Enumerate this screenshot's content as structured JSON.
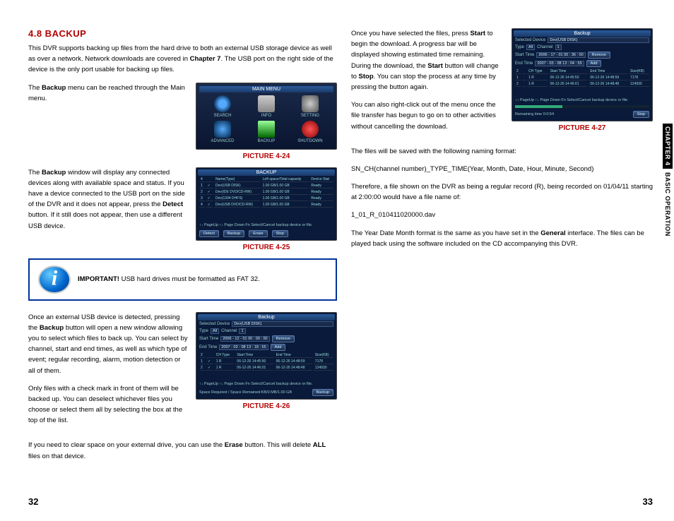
{
  "section": {
    "header": "4.8 BACKUP",
    "intro": "This DVR supports backing up files from the hard drive to both an external USB storage device as well as over a network. Network downloads are covered in ",
    "intro_bold": "Chapter 7",
    "intro2": ". The USB port on the right side of the device is the only port usable for backing up files."
  },
  "p1": {
    "pre": "The ",
    "bold": "Backup",
    "post": " menu can be reached through the Main menu."
  },
  "p2": {
    "pre": "The ",
    "bold": "Backup",
    "post": " window will display any connected devices along with available space and status. If you have a device connected to the USB port on the side of the DVR and it does not appear, press the ",
    "bold2": "Detect",
    "post2": " button. If it still does not appear, then use a different USB device."
  },
  "important": {
    "label": "IMPORTANT!",
    "text": " USB hard drives must be formatted as FAT 32."
  },
  "p3": {
    "pre": "Once an external USB device is detected, pressing the ",
    "bold": "Backup",
    "post": " button will open a new window allowing you to select which files to back up. You can select by channel, start and end times, as well as which type of event; regular recording, alarm, motion detection or all of them."
  },
  "p4": "Only files with a check mark in front of them will be backed up. You can deselect whichever files you choose or select them all by selecting the box at the top of the list.",
  "p5": {
    "pre": "If you need to clear space on your external drive, you can use the ",
    "bold": "Erase",
    "post": " button. This will delete ",
    "bold2": "ALL",
    "post2": " files on that device."
  },
  "r1": {
    "pre": "Once you have selected the files, press ",
    "bold": "Start",
    "mid": " to begin the download. A progress bar will be displayed showing estimated time remaining. During the download, the ",
    "bold2": "Start",
    "mid2": " button will change to ",
    "bold3": "Stop",
    "post": ". You can stop the process at any time by pressing the button again."
  },
  "r2": "You can also right-click out of the menu once the file transfer has begun to go on to other activities without cancelling the download.",
  "r3": "The files will be saved with the following naming format:",
  "r4": "SN_CH(channel number)_TYPE_TIME(Year, Month, Date, Hour, Minute, Second)",
  "r5": "Therefore, a file shown on the DVR as being a regular record (R), being recorded on 01/04/11 starting at 2:00:00 would have a file name of:",
  "r6": "1_01_R_010411020000.dav",
  "r7": {
    "pre": " The Year Date Month format is the same as you have set in the ",
    "bold": "General",
    "post": " interface. The files can be played back using the software included on the CD accompanying this DVR."
  },
  "captions": {
    "c24": "PICTURE 4-24",
    "c25": "PICTURE 4-25",
    "c26": "PICTURE 4-26",
    "c27": "PICTURE 4-27"
  },
  "pages": {
    "left": "32",
    "right": "33"
  },
  "sidetab": {
    "chapter": "CHAPTER 4",
    "rest": " BASIC OPERATION"
  },
  "shot24": {
    "title": "MAIN MENU",
    "items": [
      "SEARCH",
      "INFO",
      "SETTING",
      "ADVANCED",
      "BACKUP",
      "SHUTDOWN"
    ]
  },
  "shot25": {
    "title": "BACKUP",
    "count": "4",
    "rows": [
      [
        "1",
        "✓",
        "Dev(USB DISK)",
        "1.00 GB/1.00 GB",
        "Ready"
      ],
      [
        "2",
        "✓",
        "Dev(IDE DVD/CD-RW)",
        "1.00 GB/1.00 GB",
        "Ready"
      ],
      [
        "3",
        "✓",
        "Dev(1394 DHFS)",
        "1.00 GB/1.00 GB",
        "Ready"
      ],
      [
        "4",
        "✓",
        "Dev(USB DVD/CD-RW)",
        "1.00 GB/1.00 GB",
        "Ready"
      ]
    ],
    "hint": "↑↓ PageUp   ↑↓ Page Down   Fn Select/Cancel backup device or file.",
    "buttons": [
      "Detect",
      "Backup",
      "Erase",
      "Stop"
    ]
  },
  "shot26": {
    "title": "Backup",
    "seldev_label": "Selected Device",
    "seldev": "Dev(USB DISK)",
    "type_label": "Type",
    "type": "All",
    "channel_label": "Channel",
    "channel": "1",
    "start_label": "Start Time",
    "start": "2006 - 12 - 01  00 : 00 : 00",
    "end_label": "End Time",
    "end": "2007 - 03 - 08  13 : 18 : 55",
    "btn_remove": "Remove",
    "btn_add": "Add",
    "cols": [
      "CH Type",
      "Start Time",
      "End Time",
      "Size(KB)"
    ],
    "rows": [
      [
        "1",
        "✓",
        "1 R",
        "06-12-26 14:45:50",
        "06-12-26 14:48:59",
        "7178"
      ],
      [
        "2",
        "✓",
        "1 R",
        "06-12-26 14:46:01",
        "06-12-26 14:48:48",
        "124930"
      ]
    ],
    "hint": "↑↓ PageUp   ↑↓ Page Down   Fn Select/Cancel backup device or file.",
    "footer": "Space Required / Space Remained:KB/0 MB/1.00 GB",
    "btn_backup": "Backup"
  },
  "shot27": {
    "title": "Backup",
    "seldev_label": "Selected Device",
    "seldev": "Dev(USB DISK)",
    "type_label": "Type",
    "type": "All",
    "channel_label": "Channel",
    "channel": "1",
    "start_label": "Start Time",
    "start": "2006 - 17 - 01  00 : 36 : 00",
    "end_label": "End Time",
    "end": "2007 - 03 - 08  13 : 04 : 55",
    "btn_remove": "Remove",
    "btn_add": "Add",
    "cols": [
      "CH Type",
      "Start Time",
      "End Time",
      "Size(KB)"
    ],
    "rows": [
      [
        "1",
        "",
        "1 R",
        "06-12-26 14:45:50",
        "06-12-26 14:48:59",
        "7178"
      ],
      [
        "2",
        "",
        "1 R",
        "06-12-26 14:46:01",
        "06-12-26 14:48:48",
        "124930"
      ]
    ],
    "hint": "↑↓ PageUp   ↑↓ Page Down   Fn Select/Cancel backup device or file.",
    "remaining": "Remaining time 0:0:54",
    "btn_stop": "Stop"
  }
}
